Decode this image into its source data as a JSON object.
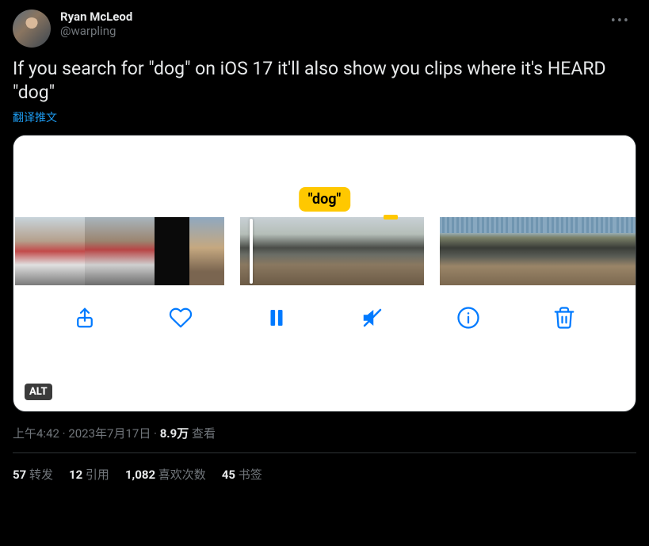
{
  "author": {
    "display_name": "Ryan McLeod",
    "handle": "@warpling"
  },
  "tweet_text": "If you search for \"dog\" on iOS 17 it'll also show you clips where it's HEARD \"dog\"",
  "translate_label": "翻译推文",
  "media": {
    "highlight_label": "\"dog\"",
    "alt_badge": "ALT",
    "toolbar_icons": [
      "share",
      "heart",
      "pause",
      "mute",
      "info",
      "trash"
    ]
  },
  "meta": {
    "time": "上午4:42",
    "date": "2023年7月17日",
    "views_count": "8.9万",
    "views_label": "查看"
  },
  "stats": {
    "retweets": {
      "count": "57",
      "label": "转发"
    },
    "quotes": {
      "count": "12",
      "label": "引用"
    },
    "likes": {
      "count": "1,082",
      "label": "喜欢次数"
    },
    "bookmarks": {
      "count": "45",
      "label": "书签"
    }
  }
}
